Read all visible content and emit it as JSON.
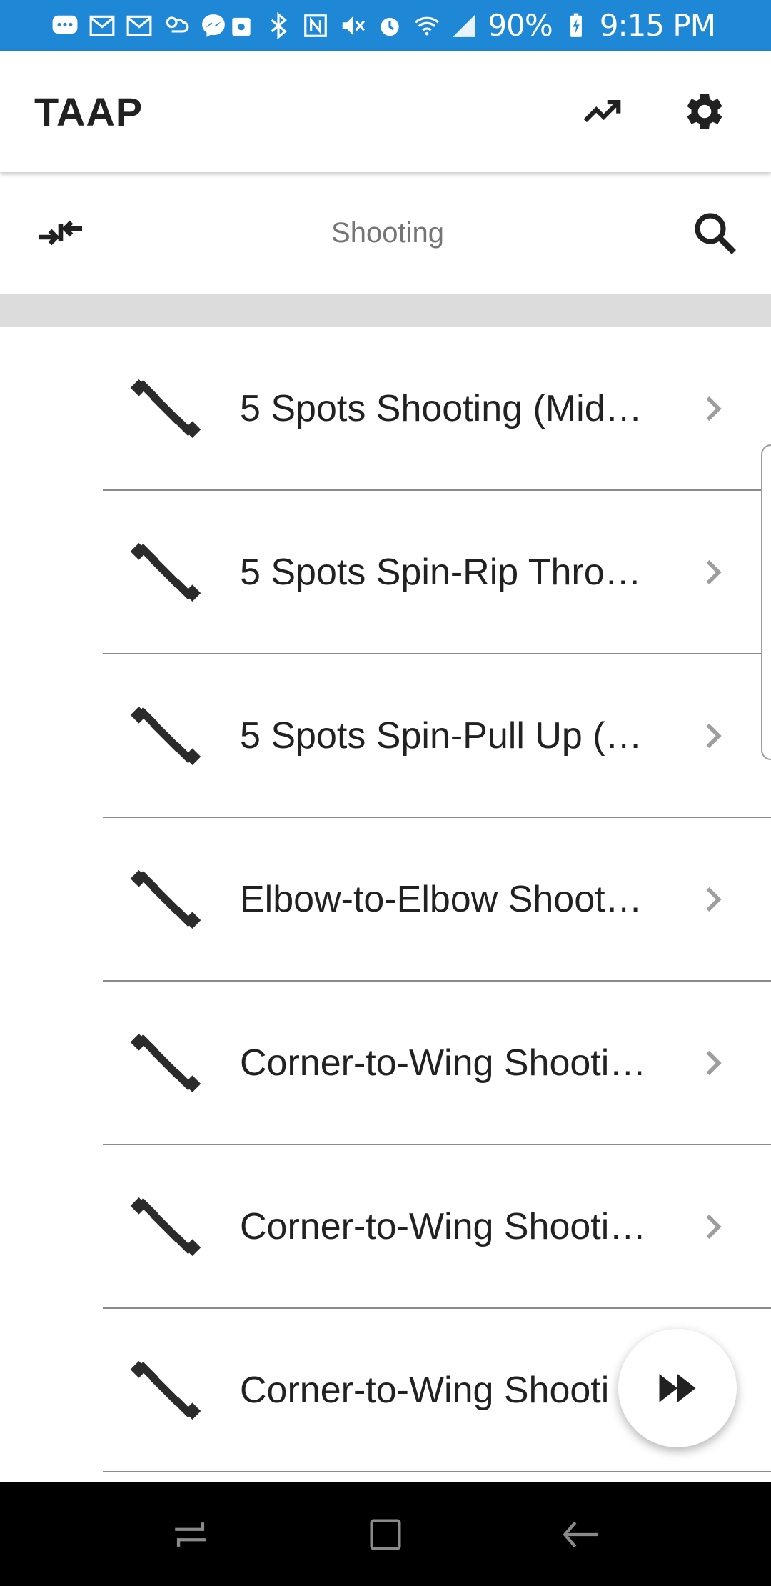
{
  "status_bar": {
    "battery": "90%",
    "time": "9:15 PM",
    "left_icons": [
      "chat-bubble-icon",
      "mail-icon",
      "mail-icon",
      "weather-icon",
      "messenger-icon"
    ],
    "right_icons": [
      "android-icon",
      "bluetooth-icon",
      "nfc-icon",
      "mute-icon",
      "alarm-icon",
      "wifi-icon",
      "signal-icon",
      "battery-icon"
    ]
  },
  "app_bar": {
    "title": "TAAP",
    "actions": [
      "trending-up-icon",
      "settings-gear-icon"
    ]
  },
  "filter_bar": {
    "label": "Shooting",
    "left_icon": "compress-arrows-icon",
    "right_icon": "search-icon"
  },
  "drills": [
    {
      "label": "5 Spots Shooting (Mid…",
      "icon": "dumbbell-icon"
    },
    {
      "label": "5 Spots Spin-Rip Thro…",
      "icon": "dumbbell-icon"
    },
    {
      "label": "5 Spots Spin-Pull Up (…",
      "icon": "dumbbell-icon"
    },
    {
      "label": "Elbow-to-Elbow Shoot…",
      "icon": "dumbbell-icon"
    },
    {
      "label": "Corner-to-Wing Shooti…",
      "icon": "dumbbell-icon"
    },
    {
      "label": "Corner-to-Wing Shooti…",
      "icon": "dumbbell-icon"
    },
    {
      "label": "Corner-to-Wing Shooti",
      "icon": "dumbbell-icon"
    }
  ],
  "fab": {
    "icon": "fast-forward-icon"
  },
  "nav_bar": {
    "buttons": [
      "recents-icon",
      "home-icon",
      "back-icon"
    ]
  },
  "colors": {
    "status_bar": "#1e88d6",
    "text": "#212121",
    "divider": "#dcdcdc"
  }
}
